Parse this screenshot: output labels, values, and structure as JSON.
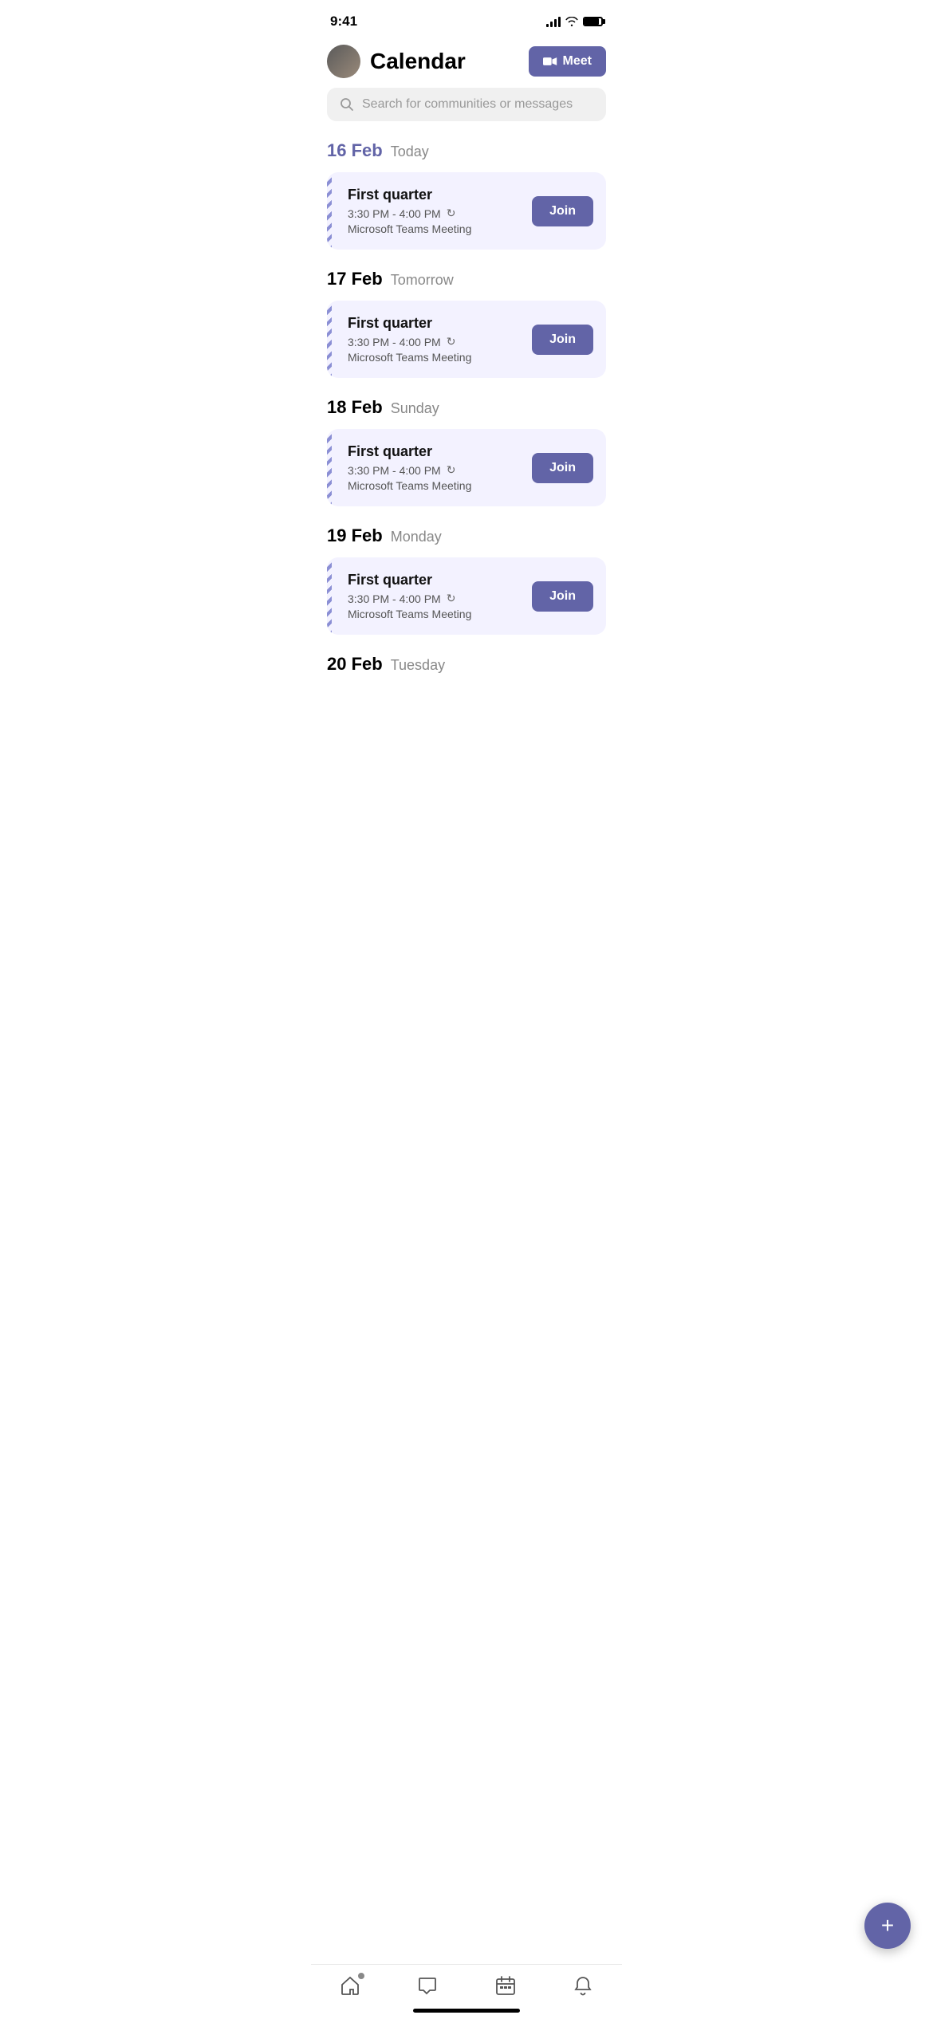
{
  "statusBar": {
    "time": "9:41"
  },
  "header": {
    "title": "Calendar",
    "meetButton": "Meet"
  },
  "search": {
    "placeholder": "Search for communities or messages"
  },
  "dates": [
    {
      "id": "feb16",
      "dayNum": "16",
      "month": "Feb",
      "label": "Today",
      "isToday": true,
      "events": [
        {
          "title": "First quarter",
          "timeRange": "3:30 PM - 4:00 PM",
          "type": "Microsoft Teams Meeting",
          "joinLabel": "Join"
        }
      ]
    },
    {
      "id": "feb17",
      "dayNum": "17",
      "month": "Feb",
      "label": "Tomorrow",
      "isToday": false,
      "events": [
        {
          "title": "First quarter",
          "timeRange": "3:30 PM - 4:00 PM",
          "type": "Microsoft Teams Meeting",
          "joinLabel": "Join"
        }
      ]
    },
    {
      "id": "feb18",
      "dayNum": "18",
      "month": "Feb",
      "label": "Sunday",
      "isToday": false,
      "events": [
        {
          "title": "First quarter",
          "timeRange": "3:30 PM - 4:00 PM",
          "type": "Microsoft Teams Meeting",
          "joinLabel": "Join"
        }
      ]
    },
    {
      "id": "feb19",
      "dayNum": "19",
      "month": "Feb",
      "label": "Monday",
      "isToday": false,
      "events": [
        {
          "title": "First quarter",
          "timeRange": "3:30 PM - 4:00 PM",
          "type": "Microsoft Teams Meeting",
          "joinLabel": "Join"
        }
      ]
    },
    {
      "id": "feb20",
      "dayNum": "20",
      "month": "Feb",
      "label": "Tuesday",
      "isToday": false,
      "events": []
    }
  ],
  "fab": {
    "label": "+"
  },
  "bottomNav": [
    {
      "id": "home",
      "label": "Home",
      "active": false,
      "hasBadge": true
    },
    {
      "id": "chat",
      "label": "Chat",
      "active": false,
      "hasBadge": false
    },
    {
      "id": "calendar",
      "label": "Calendar",
      "active": true,
      "hasBadge": false
    },
    {
      "id": "notifications",
      "label": "Notifications",
      "active": false,
      "hasBadge": false
    }
  ],
  "colors": {
    "accent": "#6264a7",
    "todayColor": "#6264a7",
    "cardBg": "#f3f2ff"
  }
}
